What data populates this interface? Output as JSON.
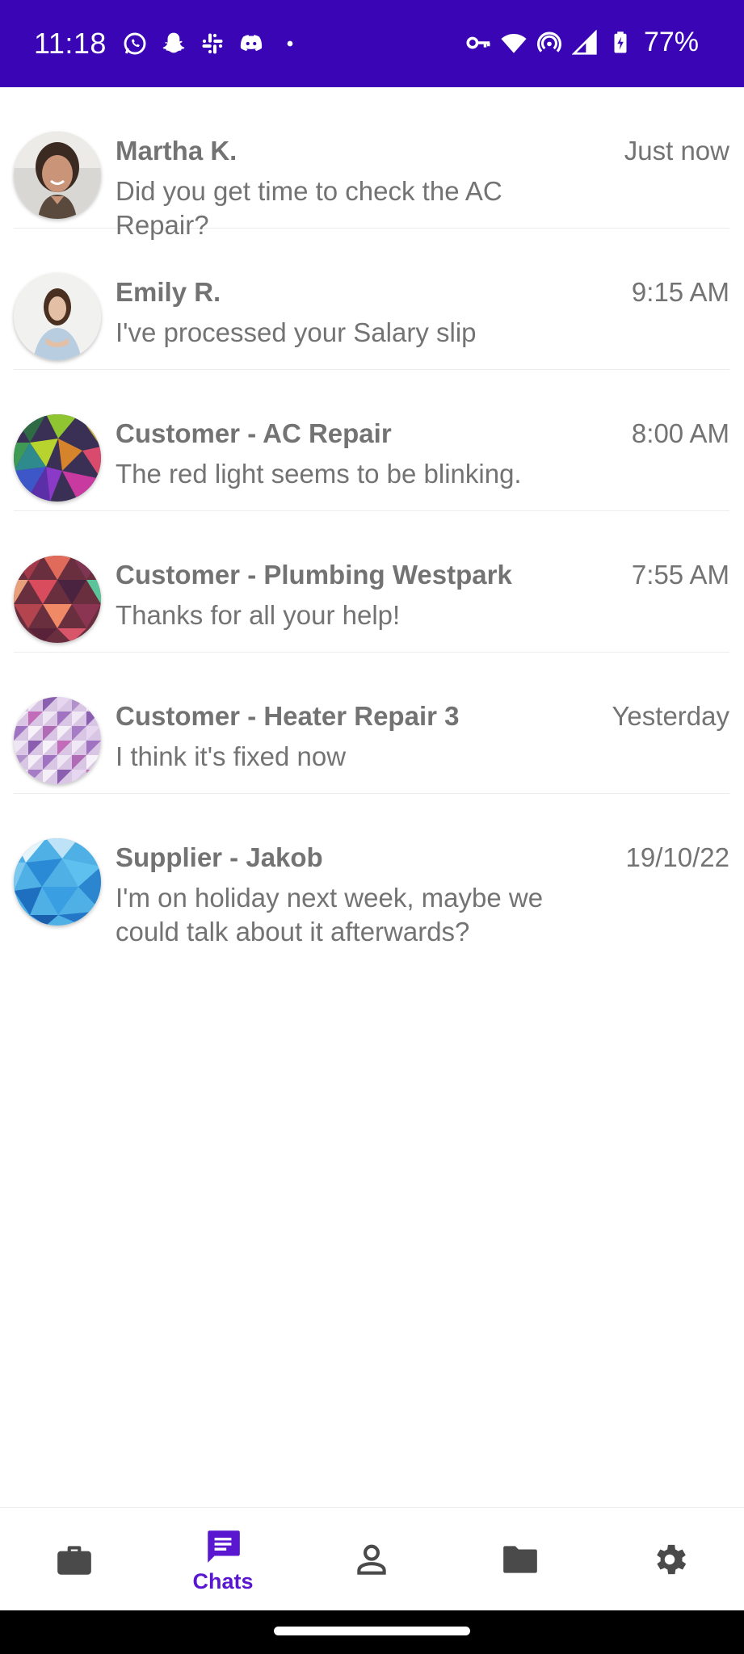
{
  "status_bar": {
    "time": "11:18",
    "battery": "77%",
    "left_icons": [
      "whatsapp-icon",
      "snapchat-icon",
      "slack-icon",
      "discord-icon",
      "dot-icon"
    ],
    "right_icons": [
      "vpn-key-icon",
      "wifi-icon",
      "hotspot-icon",
      "cell-signal-icon",
      "battery-charging-icon"
    ]
  },
  "chats": [
    {
      "name": "Martha K.",
      "time": "Just now",
      "message": "Did you get time to check the AC Repair?"
    },
    {
      "name": "Emily R.",
      "time": "9:15 AM",
      "message": "I've processed your Salary slip"
    },
    {
      "name": "Customer - AC Repair",
      "time": "8:00 AM",
      "message": "The red light seems to be blinking."
    },
    {
      "name": "Customer - Plumbing Westpark",
      "time": "7:55 AM",
      "message": "Thanks for all your help!"
    },
    {
      "name": "Customer - Heater Repair 3",
      "time": "Yesterday",
      "message": "I think it's fixed now"
    },
    {
      "name": "Supplier - Jakob",
      "time": "19/10/22",
      "message": "I'm on holiday next week, maybe we could talk about it afterwards?"
    }
  ],
  "bottom_nav": {
    "active": "chats",
    "chats_label": "Chats",
    "items": [
      "briefcase-icon",
      "chat-icon",
      "person-icon",
      "folder-icon",
      "gear-icon"
    ]
  },
  "colors": {
    "status_bar": "#3a05b5",
    "accent": "#5a17d0",
    "text": "#737373",
    "icon_inactive": "#4a4a4a"
  }
}
